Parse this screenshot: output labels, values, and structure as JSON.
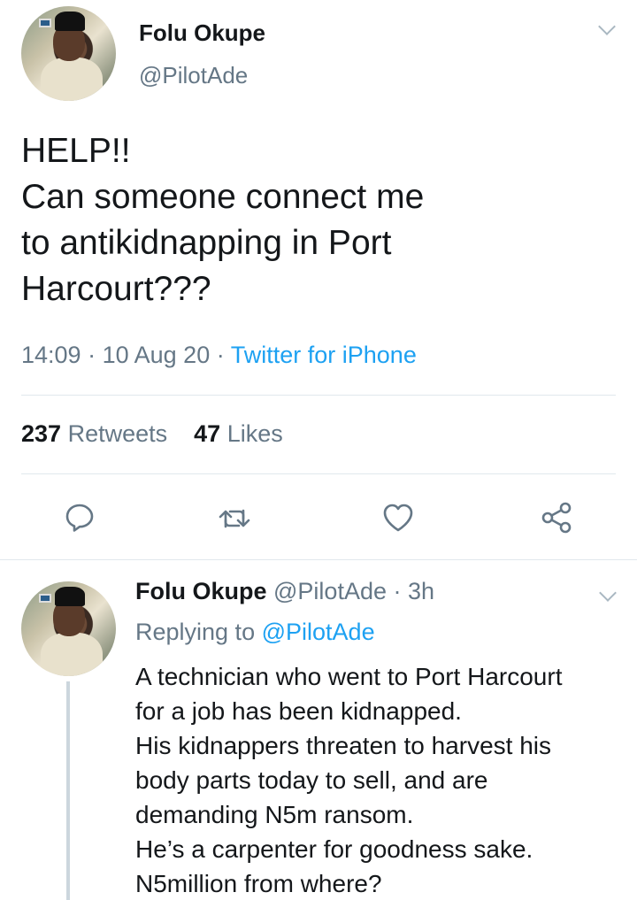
{
  "tweet": {
    "author_name": "Folu Okupe",
    "author_handle": "@PilotAde",
    "text": "HELP!!\nCan someone connect me\nto antikidnapping in Port\nHarcourt???",
    "time": "14:09",
    "date": "10 Aug 20",
    "source": "Twitter for iPhone",
    "retweets_count": "237",
    "retweets_label": "Retweets",
    "likes_count": "47",
    "likes_label": "Likes"
  },
  "actions": {
    "reply_icon": "speech-bubble-icon",
    "retweet_icon": "retweet-icon",
    "like_icon": "heart-icon",
    "share_icon": "share-nodes-icon"
  },
  "reply": {
    "author_name": "Folu Okupe",
    "author_handle": "@PilotAde",
    "age": "3h",
    "replying_to_label": "Replying to",
    "replying_to_handle": "@PilotAde",
    "text": "A technician who went to Port Harcourt\nfor a job has been kidnapped.\nHis kidnappers threaten to harvest his\nbody parts today to sell, and are\ndemanding N5m ransom.\nHe’s a carpenter for goodness sake.\nN5million from where?"
  },
  "colors": {
    "link": "#1da1f2",
    "secondary_text": "#657786",
    "divider": "#e1e8ed"
  }
}
